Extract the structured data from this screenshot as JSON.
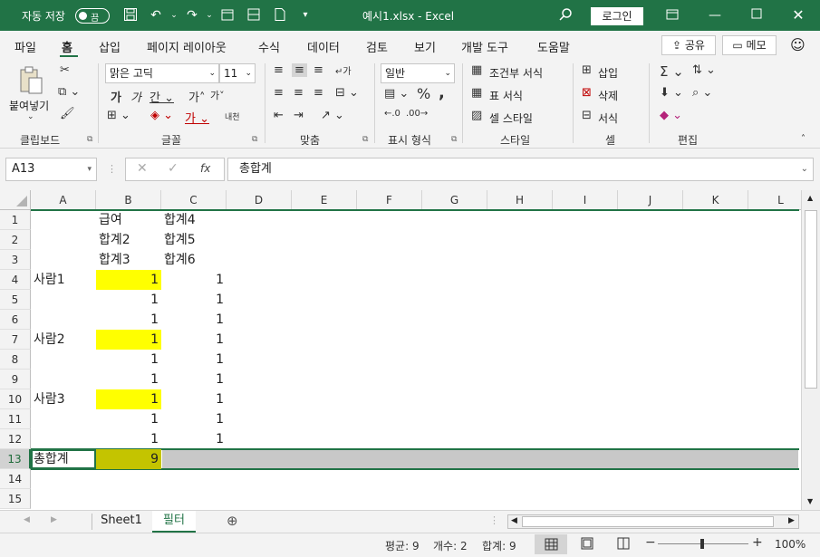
{
  "titlebar": {
    "autosave_label": "자동 저장",
    "autosave_state": "끔",
    "title": "예시1.xlsx  -  Excel",
    "login_label": "로그인",
    "bg_color": "#217346"
  },
  "menu": {
    "tabs": [
      "파일",
      "홈",
      "삽입",
      "페이지 레이아웃",
      "수식",
      "데이터",
      "검토",
      "보기",
      "개발 도구",
      "도움말"
    ],
    "active_tab": "홈",
    "share_label": "공유",
    "memo_label": "메모"
  },
  "ribbon": {
    "clipboard": {
      "paste_label": "붙여넣기",
      "group_label": "클립보드"
    },
    "font": {
      "font_name": "맑은 고딕",
      "font_size": "11",
      "group_label": "글꼴"
    },
    "alignment": {
      "group_label": "맞춤"
    },
    "number": {
      "format": "일반",
      "group_label": "표시 형식"
    },
    "styles": {
      "conditional_label": "조건부 서식",
      "table_label": "표 서식",
      "cell_style_label": "셀 스타일",
      "group_label": "스타일"
    },
    "cells": {
      "insert_label": "삽입",
      "delete_label": "삭제",
      "format_label": "서식",
      "group_label": "셀"
    },
    "editing": {
      "group_label": "편집"
    }
  },
  "formula_bar": {
    "name_box": "A13",
    "formula": "총합계"
  },
  "columns": [
    "A",
    "B",
    "C",
    "D",
    "E",
    "F",
    "G",
    "H",
    "I",
    "J",
    "K",
    "L"
  ],
  "rows": [
    "1",
    "2",
    "3",
    "4",
    "5",
    "6",
    "7",
    "8",
    "9",
    "10",
    "11",
    "12",
    "13",
    "14",
    "15"
  ],
  "cells": {
    "B1": "급여",
    "C1": "합계4",
    "B2": "합계2",
    "C2": "합계5",
    "B3": "합계3",
    "C3": "합계6",
    "A4": "사람1",
    "B4": "1",
    "C4": "1",
    "B5": "1",
    "C5": "1",
    "B6": "1",
    "C6": "1",
    "A7": "사람2",
    "B7": "1",
    "C7": "1",
    "B8": "1",
    "C8": "1",
    "B9": "1",
    "C9": "1",
    "A10": "사람3",
    "B10": "1",
    "C10": "1",
    "B11": "1",
    "C11": "1",
    "B12": "1",
    "C12": "1",
    "A13": "총합계",
    "B13": "9"
  },
  "highlight_colors": {
    "yellow": "#ffff00",
    "olive": "#c4c400",
    "selection_green": "#217346"
  },
  "sheets": [
    "Sheet1",
    "필터"
  ],
  "active_sheet": "필터",
  "status": {
    "average": "평균: 9",
    "count": "개수: 2",
    "sum": "합계: 9",
    "zoom": "100%"
  }
}
